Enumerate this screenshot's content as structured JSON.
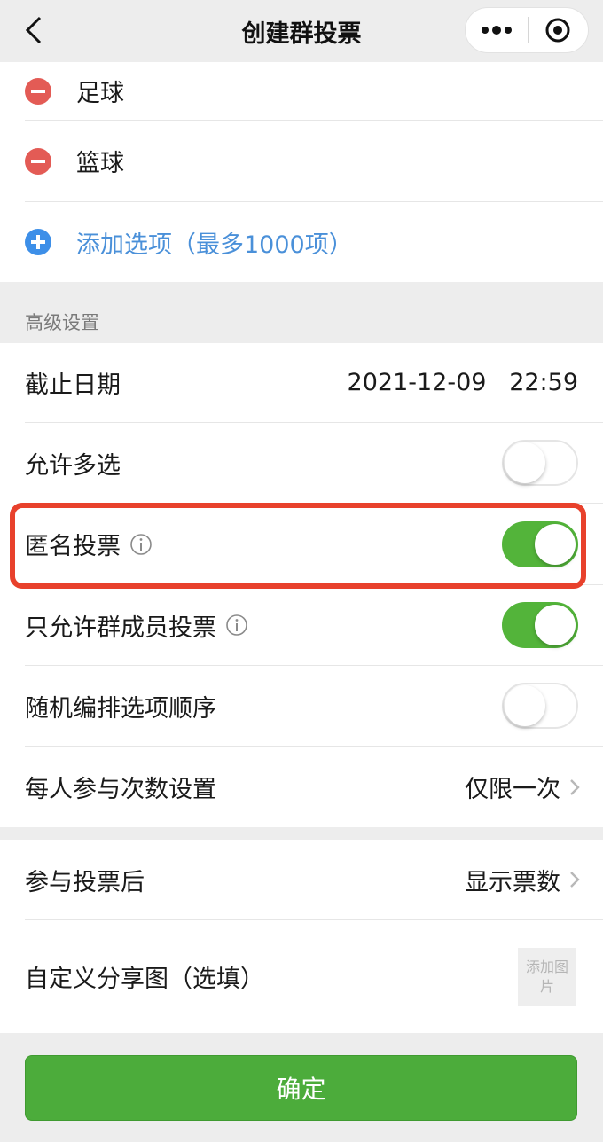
{
  "header": {
    "title": "创建群投票"
  },
  "options": [
    {
      "label": "足球",
      "icon": "remove-circle-icon"
    },
    {
      "label": "篮球",
      "icon": "remove-circle-icon"
    }
  ],
  "add_option_label": "添加选项（最多1000项）",
  "advanced": {
    "title": "高级设置",
    "deadline_label": "截止日期",
    "deadline_value": "2021-12-09   22:59",
    "multi_select_label": "允许多选",
    "multi_select_on": false,
    "anonymous_label": "匿名投票",
    "anonymous_on": true,
    "members_only_label": "只允许群成员投票",
    "members_only_on": true,
    "random_order_label": "随机编排选项顺序",
    "random_order_on": false,
    "times_label": "每人参与次数设置",
    "times_value": "仅限一次"
  },
  "after": {
    "after_vote_label": "参与投票后",
    "after_vote_value": "显示票数",
    "share_image_label": "自定义分享图（选填）",
    "add_image_text": "添加图片"
  },
  "confirm_label": "确定",
  "colors": {
    "accent_green": "#53b43a",
    "remove_red": "#e35b55",
    "add_blue": "#3d8fe8",
    "highlight_red": "#e8412c"
  }
}
